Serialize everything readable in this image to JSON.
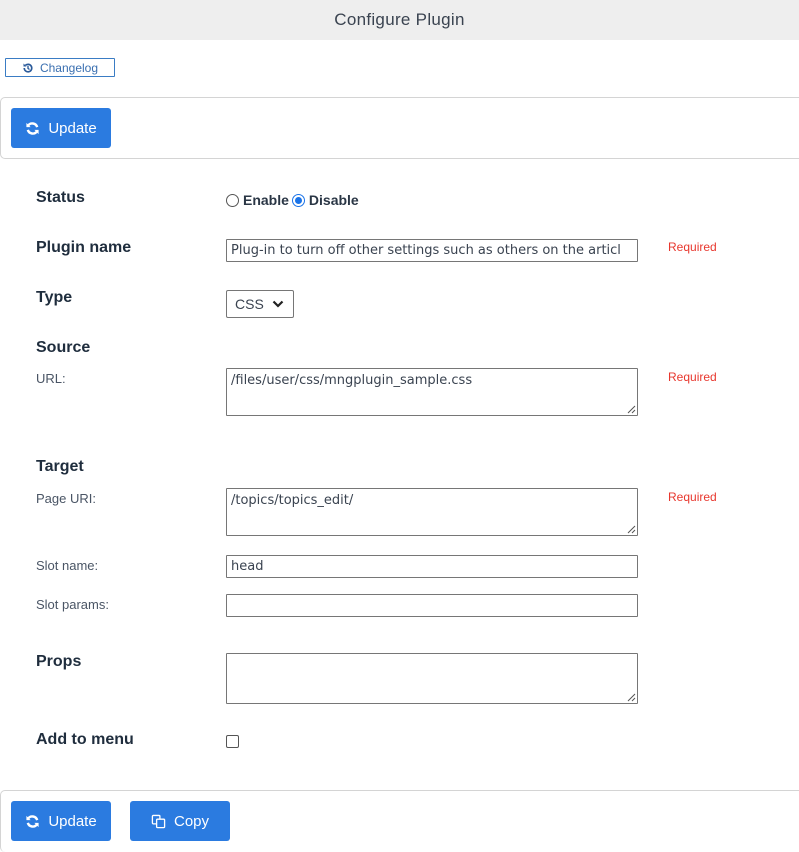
{
  "header": {
    "title": "Configure Plugin"
  },
  "changelog": {
    "label": "Changelog",
    "icon": "history-icon"
  },
  "top_toolbar": {
    "update_label": "Update",
    "update_icon": "refresh-icon"
  },
  "form": {
    "status": {
      "label": "Status",
      "options": [
        {
          "label": "Enable",
          "checked": false
        },
        {
          "label": "Disable",
          "checked": true
        }
      ]
    },
    "plugin_name": {
      "label": "Plugin name",
      "value": "Plug-in to turn off other settings such as others on the articl",
      "required": "Required"
    },
    "type": {
      "label": "Type",
      "value": "CSS"
    },
    "source": {
      "heading": "Source",
      "url_label": "URL:",
      "url_value": "/files/user/css/mngplugin_sample.css",
      "required": "Required"
    },
    "target": {
      "heading": "Target",
      "page_uri_label": "Page URI:",
      "page_uri_value": "/topics/topics_edit/",
      "page_uri_required": "Required",
      "slot_name_label": "Slot name:",
      "slot_name_value": "head",
      "slot_params_label": "Slot params:",
      "slot_params_value": ""
    },
    "props": {
      "label": "Props",
      "value": ""
    },
    "add_to_menu": {
      "label": "Add to menu",
      "checked": false
    }
  },
  "bottom_toolbar": {
    "update_label": "Update",
    "copy_label": "Copy"
  },
  "colors": {
    "primary": "#2b7be0",
    "required": "#e8372e",
    "header_bg": "#eeeeee"
  }
}
